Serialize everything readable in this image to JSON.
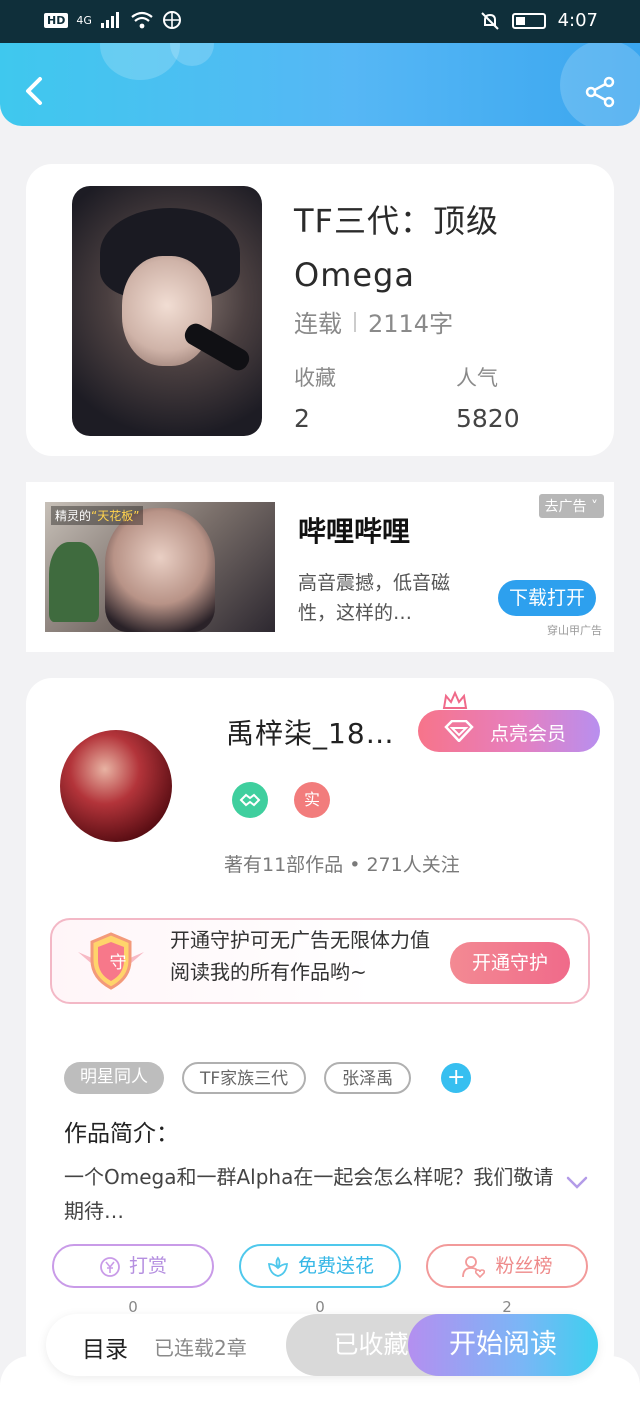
{
  "status_bar": {
    "time": "4:07",
    "network": "4G",
    "hd_label": "HD"
  },
  "book": {
    "title": "TF三代：顶级Omega",
    "status": "连载",
    "word_count": "2114字",
    "stats": [
      {
        "label": "收藏",
        "value": "2"
      },
      {
        "label": "人气",
        "value": "5820"
      }
    ]
  },
  "ad": {
    "image_caption_prefix": "精灵的",
    "image_caption_quote": "“天花板”",
    "title": "哔哩哔哩",
    "description": "高音震撼，低音磁性，这样的…",
    "tag": "去广告",
    "button": "下载打开",
    "source": "穿山甲广告"
  },
  "author": {
    "name": "禹梓柒_18…",
    "vip_button": "点亮会员",
    "badge_real": "实",
    "stats": "著有11部作品 • 271人关注",
    "guard_icon_char": "守",
    "guard_text": "开通守护可无广告无限体力值阅读我的所有作品哟~",
    "guard_button": "开通守护"
  },
  "tags": {
    "items": [
      "明星同人",
      "TF家族三代",
      "张泽禹"
    ],
    "add": "+"
  },
  "intro": {
    "label": "作品简介：",
    "text": "一个Omega和一群Alpha在一起会怎么样呢？我们敬请期待…"
  },
  "actions": [
    {
      "label": "打赏",
      "count": "0",
      "color": "#c99be8"
    },
    {
      "label": "免费送花",
      "count": "0",
      "color": "#4fc8ec"
    },
    {
      "label": "粉丝榜",
      "count": "2",
      "color": "#f29a9a"
    }
  ],
  "bottom": {
    "catalog": "目录",
    "chapters": "已连载2章",
    "collected": "已收藏",
    "read": "开始阅读"
  },
  "colors": {
    "header_start": "#3fc8ee",
    "header_end": "#3aa6ef",
    "accent_blue": "#2da0ee",
    "vip_pink": "#f7748a"
  }
}
